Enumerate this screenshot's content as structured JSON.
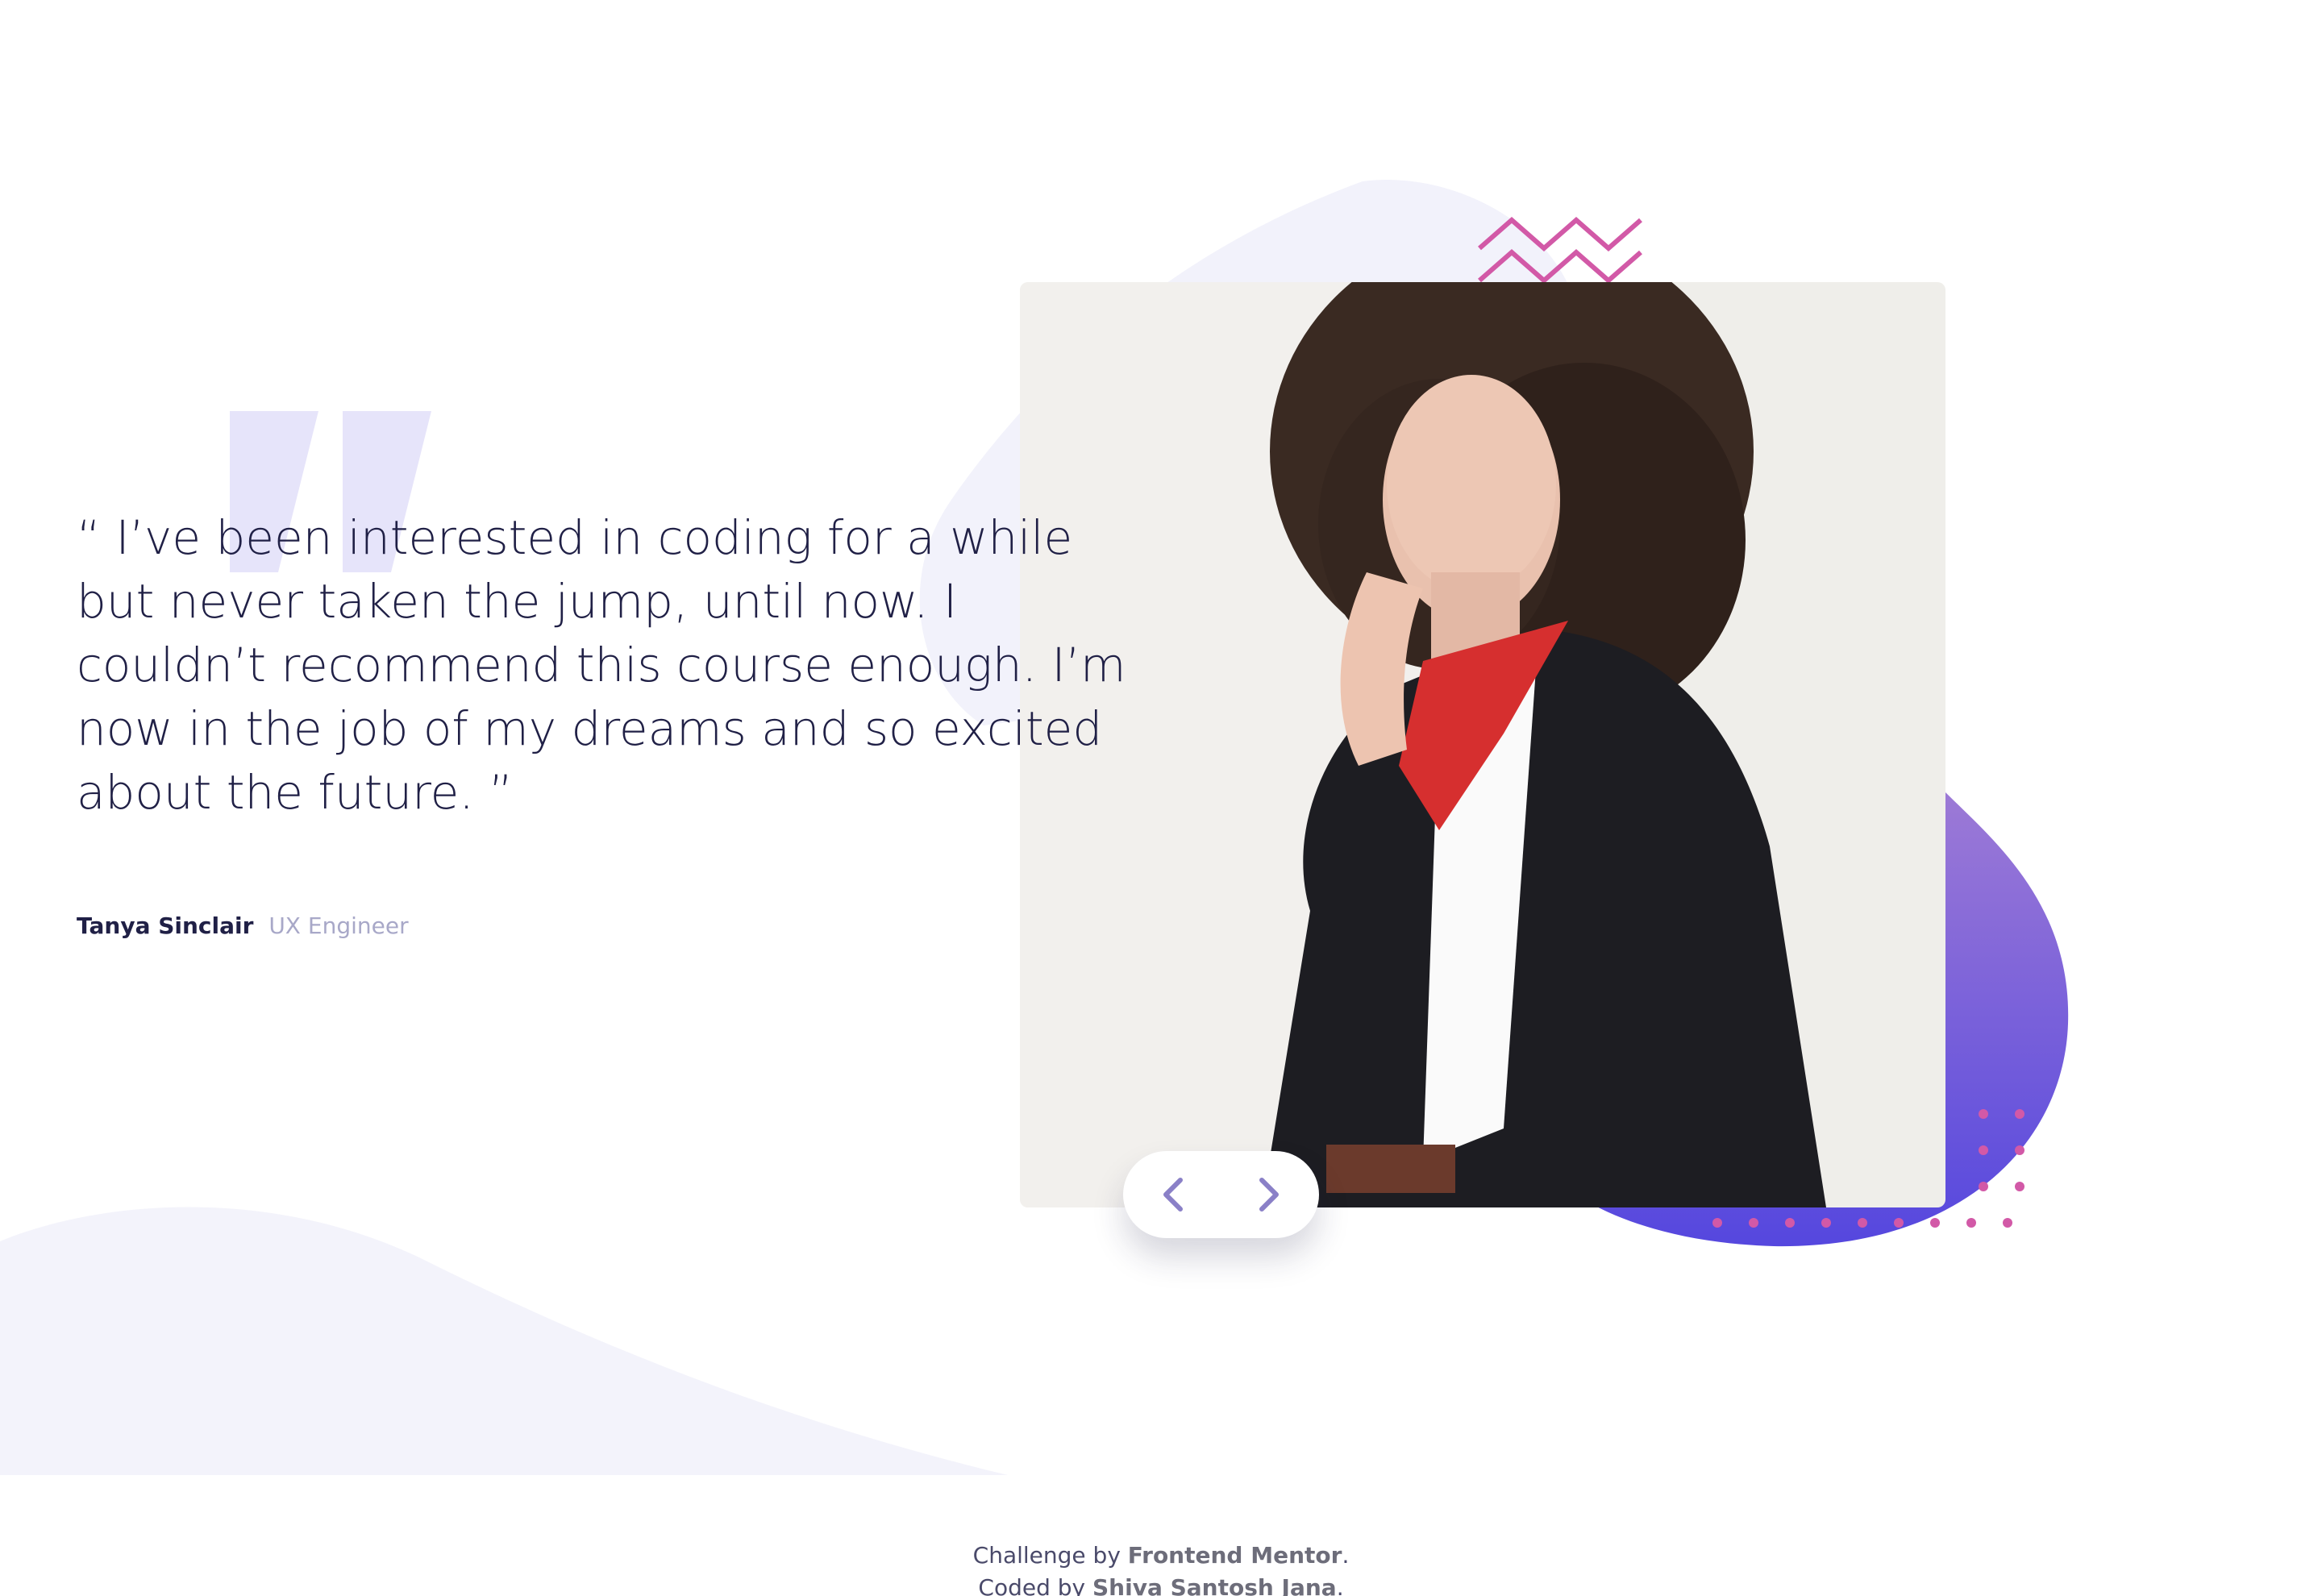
{
  "testimonial": {
    "quote": "“ I’ve been interested in coding for a while but never taken the jump, until now. I couldn’t recommend this course enough. I’m now in the job of my dreams and so excited about the future. ”",
    "author_name": "Tanya Sinclair",
    "author_role": "UX Engineer"
  },
  "navigation": {
    "prev_icon": "chevron-left-icon",
    "next_icon": "chevron-right-icon"
  },
  "footer": {
    "line1_prefix": "Challenge by ",
    "line1_link": "Frontend Mentor",
    "line1_suffix": ".",
    "line2_prefix": "Coded by ",
    "line2_link": "Shiva Santosh Jana",
    "line2_suffix": "."
  },
  "colors": {
    "text_dark": "#202046",
    "text_muted": "#a8a8c8",
    "accent_purple": "#6b5ad8",
    "accent_pink": "#d259a7",
    "bg_light": "#f2f2fb"
  }
}
